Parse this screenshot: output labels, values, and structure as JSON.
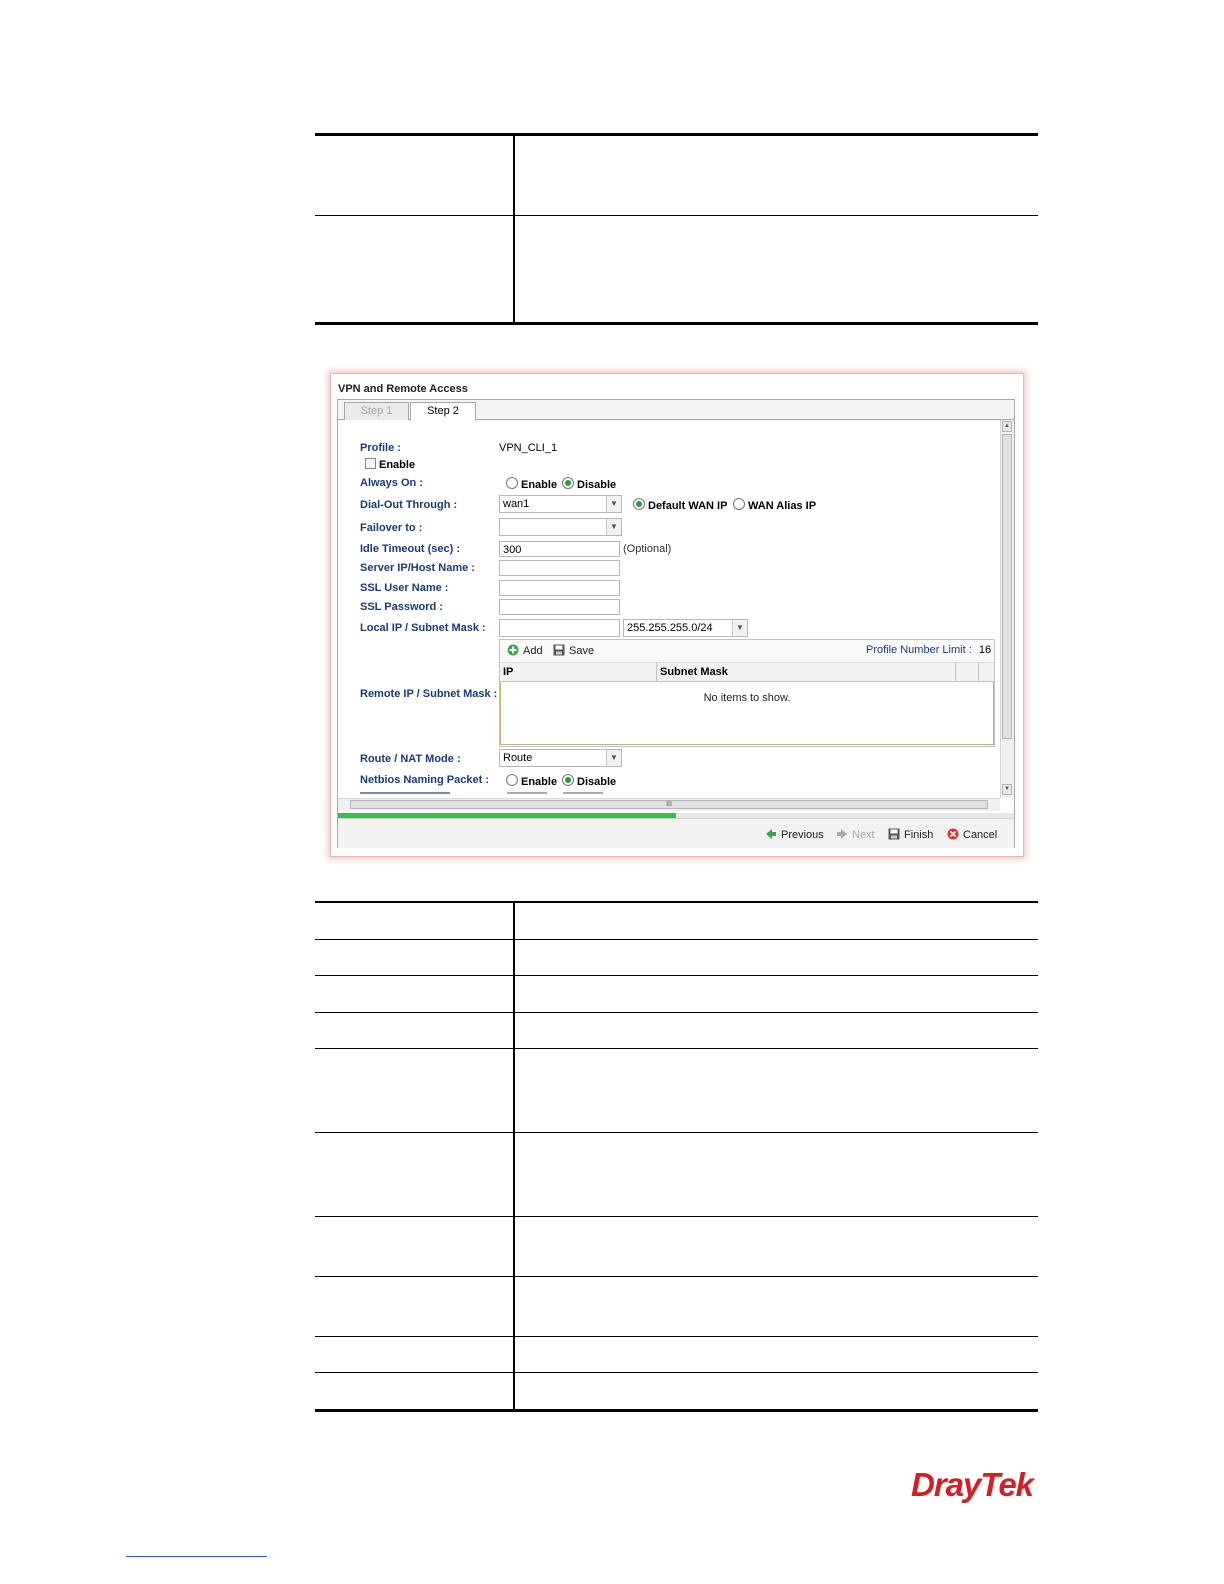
{
  "dialog": {
    "title": "VPN and Remote Access",
    "tabs": [
      {
        "label": "Step 1"
      },
      {
        "label": "Step 2"
      }
    ],
    "fields": {
      "profile_label": "Profile :",
      "profile_value": "VPN_CLI_1",
      "enable_label": "Enable",
      "always_on_label": "Always On :",
      "always_on_enable": "Enable",
      "always_on_disable": "Disable",
      "dial_out_label": "Dial-Out Through :",
      "dial_out_value": "wan1",
      "default_wan_ip": "Default WAN IP",
      "wan_alias_ip": "WAN Alias IP",
      "failover_label": "Failover to :",
      "failover_value": "",
      "idle_timeout_label": "Idle Timeout (sec) :",
      "idle_timeout_value": "300",
      "idle_timeout_hint": "(Optional)",
      "server_ip_label": "Server IP/Host Name :",
      "server_ip_value": "",
      "ssl_user_label": "SSL User Name :",
      "ssl_user_value": "",
      "ssl_password_label": "SSL Password :",
      "ssl_password_value": "",
      "local_ip_label": "Local IP / Subnet Mask :",
      "local_ip_value": "",
      "local_mask_value": "255.255.255.0/24",
      "remote_ip_label": "Remote IP / Subnet Mask :",
      "route_nat_label": "Route / NAT Mode :",
      "route_nat_value": "Route",
      "netbios_label": "Netbios Naming Packet :",
      "netbios_enable": "Enable",
      "netbios_disable": "Disable"
    },
    "grid": {
      "add_label": "Add",
      "save_label": "Save",
      "limit_label": "Profile Number Limit :",
      "limit_value": "16",
      "columns": [
        "IP",
        "Subnet Mask"
      ],
      "empty_text": "No items to show."
    },
    "progress_fraction": 0.5,
    "footer": {
      "previous": "Previous",
      "next": "Next",
      "finish": "Finish",
      "cancel": "Cancel"
    },
    "scroll_thumb_glyph": "III"
  },
  "logo_text": "DrayTek",
  "colors": {
    "label_blue": "#1a3c7a",
    "progress_green": "#2fc34a",
    "brand_red": "#d21f26"
  }
}
